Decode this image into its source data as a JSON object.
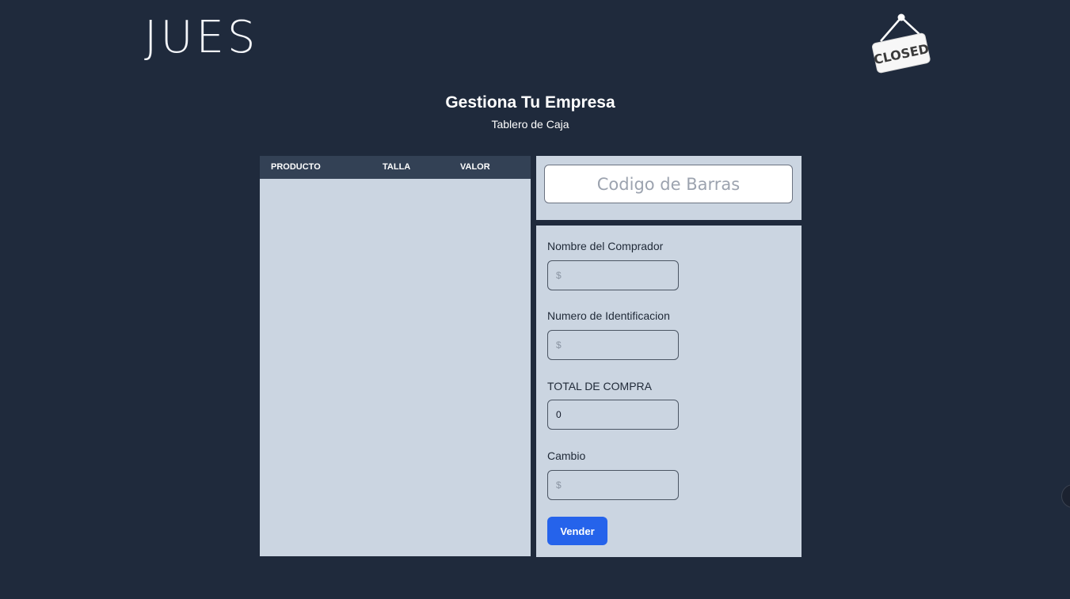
{
  "header": {
    "logo_text": "JUES",
    "closed_sign_text": "CLOSED"
  },
  "page": {
    "title": "Gestiona Tu Empresa",
    "subtitle": "Tablero de Caja"
  },
  "table": {
    "columns": [
      "PRODUCTO",
      "TALLA",
      "VALOR"
    ],
    "rows": []
  },
  "barcode": {
    "placeholder": "Codigo de Barras"
  },
  "form": {
    "buyer_name": {
      "label": "Nombre del Comprador",
      "placeholder": "$",
      "value": ""
    },
    "id_number": {
      "label": "Numero de Identificacion",
      "placeholder": "$",
      "value": ""
    },
    "total": {
      "label": "TOTAL DE COMPRA",
      "placeholder": "",
      "value": "0"
    },
    "change": {
      "label": "Cambio",
      "placeholder": "$",
      "value": ""
    },
    "submit_label": "Vender"
  },
  "colors": {
    "background": "#1f2a3c",
    "panel": "#cbd5e1",
    "table_header": "#334155",
    "accent": "#2563eb"
  }
}
